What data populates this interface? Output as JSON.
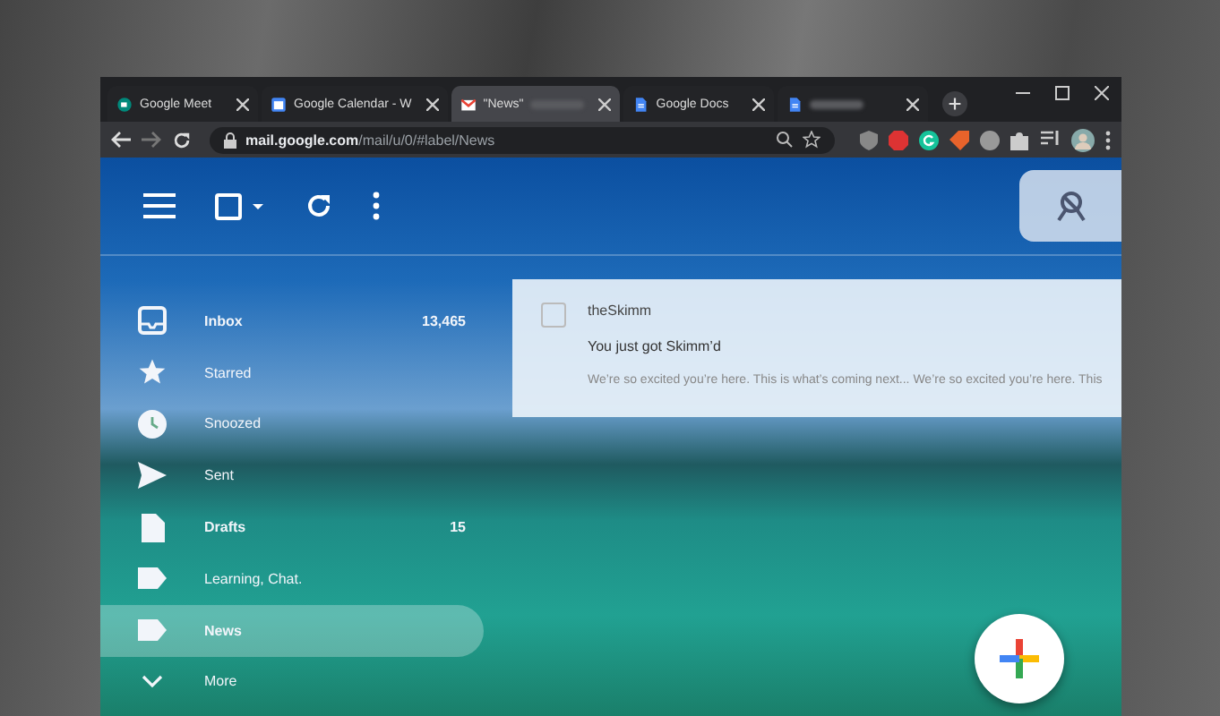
{
  "browser": {
    "tabs": [
      {
        "title": "Google Meet",
        "blurred": false,
        "selected": false
      },
      {
        "title": "Google Calendar - W",
        "blurred": false,
        "selected": false
      },
      {
        "title": "\"News\"",
        "blurred": true,
        "selected": true
      },
      {
        "title": "Google Docs",
        "blurred": false,
        "selected": false
      },
      {
        "blurred": true,
        "selected": false
      }
    ],
    "address": {
      "host": "mail.google.com",
      "path": "/mail/u/0/#label/News"
    },
    "forward_disabled": true
  },
  "toolbar": {
    "select_all_checked": false
  },
  "sidebar": {
    "items": [
      {
        "label": "Inbox",
        "count": "13,465",
        "unread": true,
        "selected": false
      },
      {
        "label": "Starred",
        "unread": false,
        "selected": false
      },
      {
        "label": "Snoozed",
        "unread": false,
        "selected": false
      },
      {
        "label": "Sent",
        "unread": false,
        "selected": false
      },
      {
        "label": "Drafts",
        "count": "15",
        "unread": true,
        "selected": false
      },
      {
        "label": "Learning, Chat.",
        "unread": false,
        "selected": false
      },
      {
        "label": "News",
        "unread": true,
        "selected": true
      },
      {
        "label": "More",
        "unread": false,
        "selected": false
      }
    ]
  },
  "email": {
    "sender": "theSkimm",
    "subject": "You just got Skimm’d",
    "snippet": "We’re so excited you’re here. This is what’s coming next... We’re so excited you’re here. This",
    "checked": false
  }
}
